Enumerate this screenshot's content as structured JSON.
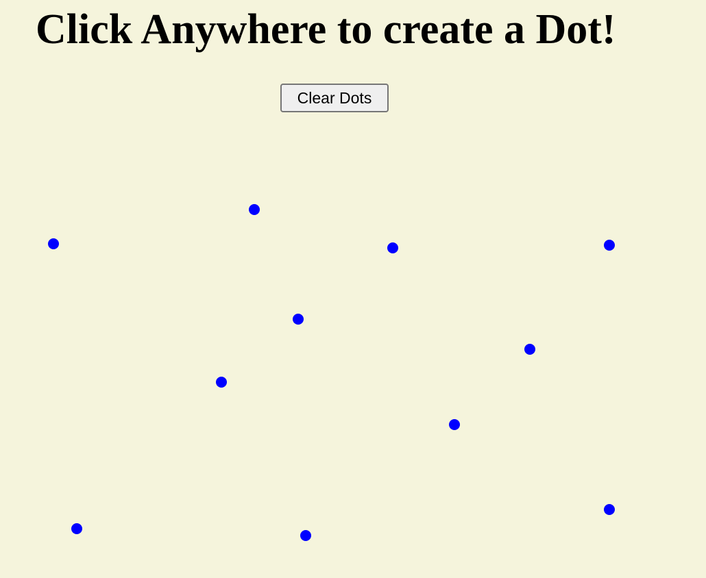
{
  "page": {
    "title": "Click Anywhere to create a Dot!",
    "background_color": "#f5f4dc"
  },
  "controls": {
    "clear_button_label": "Clear Dots"
  },
  "dots": {
    "color": "#0000ff",
    "count": 11
  }
}
